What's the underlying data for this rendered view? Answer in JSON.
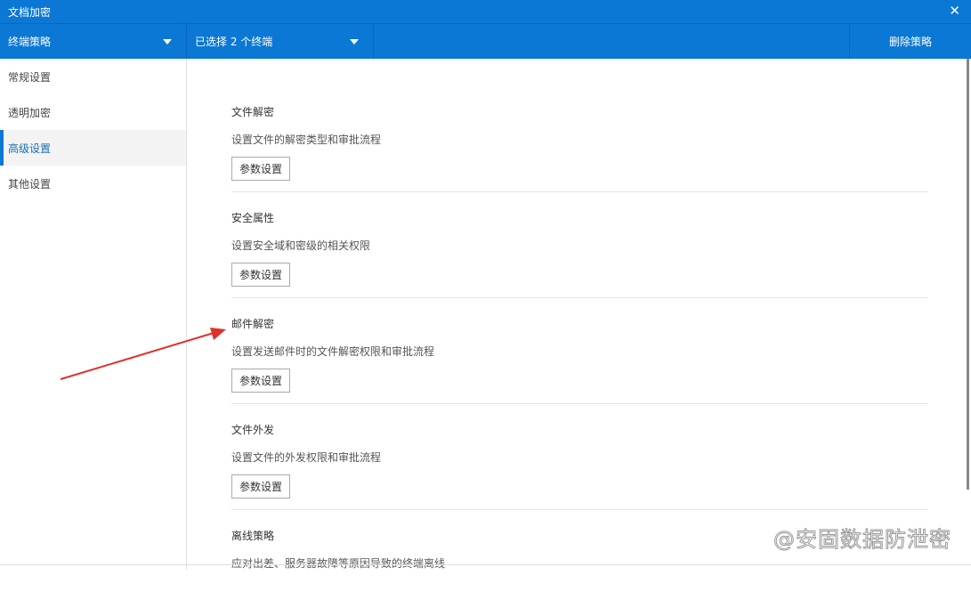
{
  "window": {
    "title": "文档加密"
  },
  "toolbar": {
    "policy": "终端策略",
    "selection": "已选择 2 个终端",
    "delete": "删除策略"
  },
  "sidebar": {
    "items": [
      {
        "label": "常规设置"
      },
      {
        "label": "透明加密"
      },
      {
        "label": "高级设置"
      },
      {
        "label": "其他设置"
      }
    ]
  },
  "sections": [
    {
      "title": "文件解密",
      "desc": "设置文件的解密类型和审批流程",
      "button": "参数设置"
    },
    {
      "title": "安全属性",
      "desc": "设置安全域和密级的相关权限",
      "button": "参数设置"
    },
    {
      "title": "邮件解密",
      "desc": "设置发送邮件时的文件解密权限和审批流程",
      "button": "参数设置"
    },
    {
      "title": "文件外发",
      "desc": "设置文件的外发权限和审批流程",
      "button": "参数设置"
    },
    {
      "title": "离线策略",
      "desc": "应对出差、服务器故障等原因导致的终端离线"
    }
  ],
  "watermark": "@安固数据防泄密",
  "colors": {
    "accent": "#0a78d4",
    "arrow": "#e0302a"
  }
}
